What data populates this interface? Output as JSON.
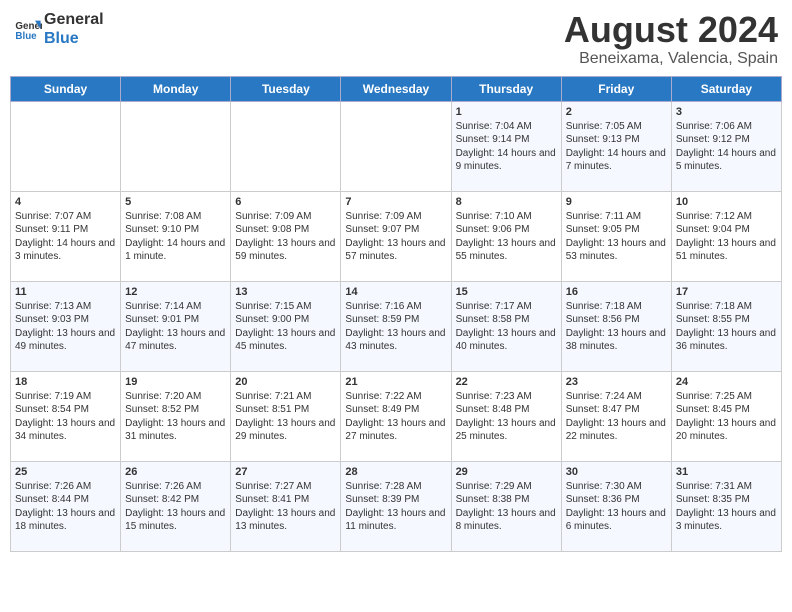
{
  "header": {
    "logo_line1": "General",
    "logo_line2": "Blue",
    "month_year": "August 2024",
    "location": "Beneixama, Valencia, Spain"
  },
  "weekdays": [
    "Sunday",
    "Monday",
    "Tuesday",
    "Wednesday",
    "Thursday",
    "Friday",
    "Saturday"
  ],
  "weeks": [
    [
      {
        "day": "",
        "detail": ""
      },
      {
        "day": "",
        "detail": ""
      },
      {
        "day": "",
        "detail": ""
      },
      {
        "day": "",
        "detail": ""
      },
      {
        "day": "1",
        "detail": "Sunrise: 7:04 AM\nSunset: 9:14 PM\nDaylight: 14 hours\nand 9 minutes."
      },
      {
        "day": "2",
        "detail": "Sunrise: 7:05 AM\nSunset: 9:13 PM\nDaylight: 14 hours\nand 7 minutes."
      },
      {
        "day": "3",
        "detail": "Sunrise: 7:06 AM\nSunset: 9:12 PM\nDaylight: 14 hours\nand 5 minutes."
      }
    ],
    [
      {
        "day": "4",
        "detail": "Sunrise: 7:07 AM\nSunset: 9:11 PM\nDaylight: 14 hours\nand 3 minutes."
      },
      {
        "day": "5",
        "detail": "Sunrise: 7:08 AM\nSunset: 9:10 PM\nDaylight: 14 hours\nand 1 minute."
      },
      {
        "day": "6",
        "detail": "Sunrise: 7:09 AM\nSunset: 9:08 PM\nDaylight: 13 hours\nand 59 minutes."
      },
      {
        "day": "7",
        "detail": "Sunrise: 7:09 AM\nSunset: 9:07 PM\nDaylight: 13 hours\nand 57 minutes."
      },
      {
        "day": "8",
        "detail": "Sunrise: 7:10 AM\nSunset: 9:06 PM\nDaylight: 13 hours\nand 55 minutes."
      },
      {
        "day": "9",
        "detail": "Sunrise: 7:11 AM\nSunset: 9:05 PM\nDaylight: 13 hours\nand 53 minutes."
      },
      {
        "day": "10",
        "detail": "Sunrise: 7:12 AM\nSunset: 9:04 PM\nDaylight: 13 hours\nand 51 minutes."
      }
    ],
    [
      {
        "day": "11",
        "detail": "Sunrise: 7:13 AM\nSunset: 9:03 PM\nDaylight: 13 hours\nand 49 minutes."
      },
      {
        "day": "12",
        "detail": "Sunrise: 7:14 AM\nSunset: 9:01 PM\nDaylight: 13 hours\nand 47 minutes."
      },
      {
        "day": "13",
        "detail": "Sunrise: 7:15 AM\nSunset: 9:00 PM\nDaylight: 13 hours\nand 45 minutes."
      },
      {
        "day": "14",
        "detail": "Sunrise: 7:16 AM\nSunset: 8:59 PM\nDaylight: 13 hours\nand 43 minutes."
      },
      {
        "day": "15",
        "detail": "Sunrise: 7:17 AM\nSunset: 8:58 PM\nDaylight: 13 hours\nand 40 minutes."
      },
      {
        "day": "16",
        "detail": "Sunrise: 7:18 AM\nSunset: 8:56 PM\nDaylight: 13 hours\nand 38 minutes."
      },
      {
        "day": "17",
        "detail": "Sunrise: 7:18 AM\nSunset: 8:55 PM\nDaylight: 13 hours\nand 36 minutes."
      }
    ],
    [
      {
        "day": "18",
        "detail": "Sunrise: 7:19 AM\nSunset: 8:54 PM\nDaylight: 13 hours\nand 34 minutes."
      },
      {
        "day": "19",
        "detail": "Sunrise: 7:20 AM\nSunset: 8:52 PM\nDaylight: 13 hours\nand 31 minutes."
      },
      {
        "day": "20",
        "detail": "Sunrise: 7:21 AM\nSunset: 8:51 PM\nDaylight: 13 hours\nand 29 minutes."
      },
      {
        "day": "21",
        "detail": "Sunrise: 7:22 AM\nSunset: 8:49 PM\nDaylight: 13 hours\nand 27 minutes."
      },
      {
        "day": "22",
        "detail": "Sunrise: 7:23 AM\nSunset: 8:48 PM\nDaylight: 13 hours\nand 25 minutes."
      },
      {
        "day": "23",
        "detail": "Sunrise: 7:24 AM\nSunset: 8:47 PM\nDaylight: 13 hours\nand 22 minutes."
      },
      {
        "day": "24",
        "detail": "Sunrise: 7:25 AM\nSunset: 8:45 PM\nDaylight: 13 hours\nand 20 minutes."
      }
    ],
    [
      {
        "day": "25",
        "detail": "Sunrise: 7:26 AM\nSunset: 8:44 PM\nDaylight: 13 hours\nand 18 minutes."
      },
      {
        "day": "26",
        "detail": "Sunrise: 7:26 AM\nSunset: 8:42 PM\nDaylight: 13 hours\nand 15 minutes."
      },
      {
        "day": "27",
        "detail": "Sunrise: 7:27 AM\nSunset: 8:41 PM\nDaylight: 13 hours\nand 13 minutes."
      },
      {
        "day": "28",
        "detail": "Sunrise: 7:28 AM\nSunset: 8:39 PM\nDaylight: 13 hours\nand 11 minutes."
      },
      {
        "day": "29",
        "detail": "Sunrise: 7:29 AM\nSunset: 8:38 PM\nDaylight: 13 hours\nand 8 minutes."
      },
      {
        "day": "30",
        "detail": "Sunrise: 7:30 AM\nSunset: 8:36 PM\nDaylight: 13 hours\nand 6 minutes."
      },
      {
        "day": "31",
        "detail": "Sunrise: 7:31 AM\nSunset: 8:35 PM\nDaylight: 13 hours\nand 3 minutes."
      }
    ]
  ]
}
